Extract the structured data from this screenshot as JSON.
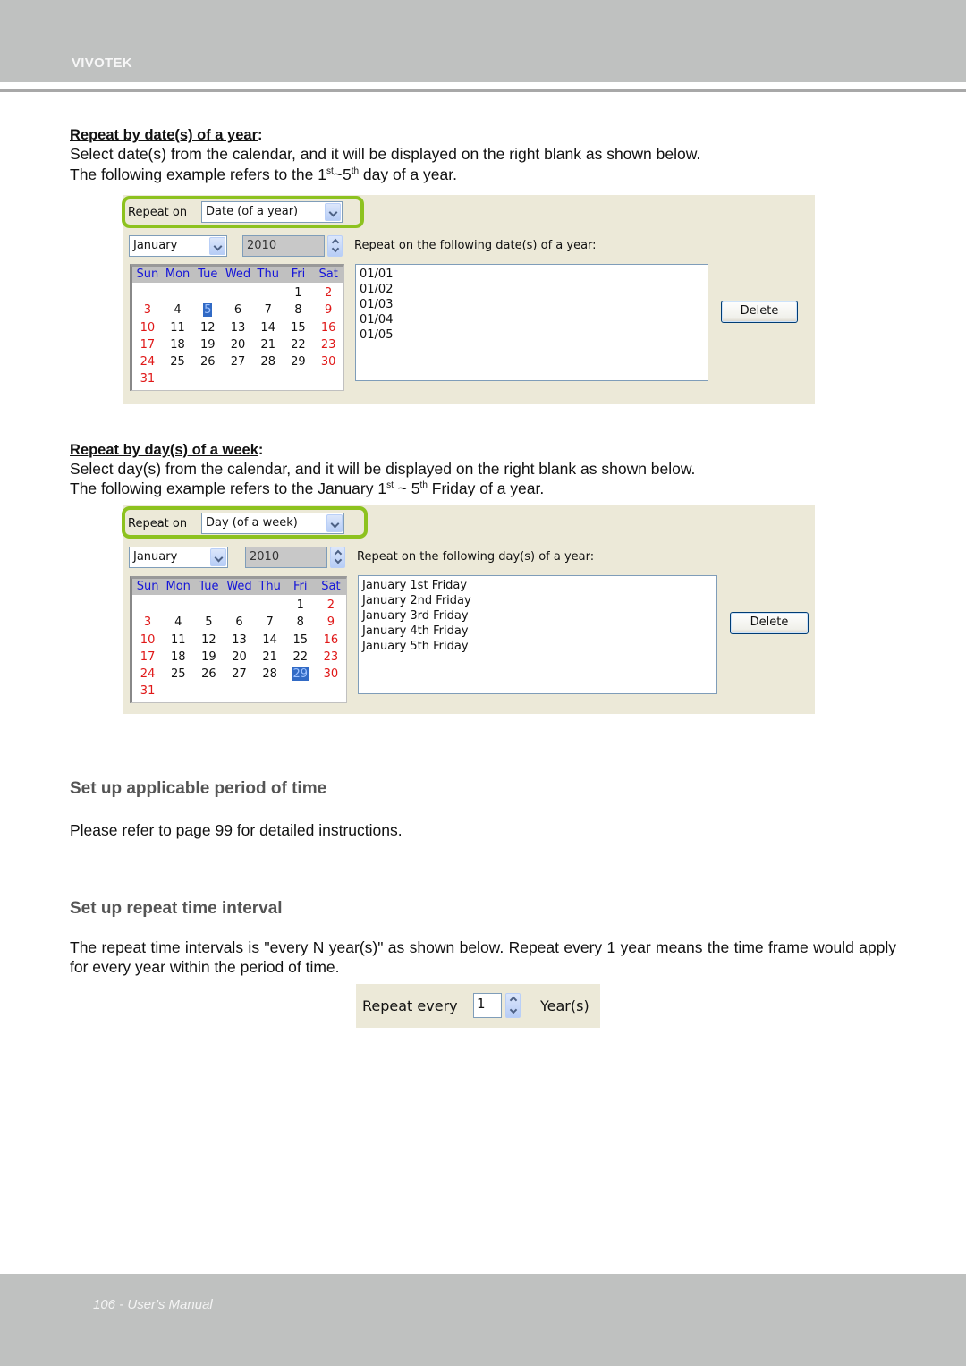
{
  "header": {
    "brand": "VIVOTEK"
  },
  "footer": {
    "page_label": "106 - User's Manual"
  },
  "section_dates": {
    "heading": "Repeat by date(s) of a year",
    "heading_suffix": ":",
    "line1": "Select date(s) from the calendar, and it will be displayed on the right blank as shown below.",
    "line2_pre": "The following example refers to the 1",
    "line2_sup1": "st",
    "line2_mid": "~5",
    "line2_sup2": "th",
    "line2_post": " day of a year."
  },
  "panel_dates": {
    "repeat_on_label": "Repeat on",
    "repeat_on_value": "Date (of a year)",
    "month_value": "January",
    "year_value": "2010",
    "list_label": "Repeat on the following date(s) of a year:",
    "list_items": [
      "01/01",
      "01/02",
      "01/03",
      "01/04",
      "01/05"
    ],
    "delete_label": "Delete",
    "weekdays": [
      "Sun",
      "Mon",
      "Tue",
      "Wed",
      "Thu",
      "Fri",
      "Sat"
    ],
    "selected_day": "5",
    "days": [
      "",
      "",
      "",
      "",
      "",
      "1",
      "2",
      "3",
      "4",
      "5",
      "6",
      "7",
      "8",
      "9",
      "10",
      "11",
      "12",
      "13",
      "14",
      "15",
      "16",
      "17",
      "18",
      "19",
      "20",
      "21",
      "22",
      "23",
      "24",
      "25",
      "26",
      "27",
      "28",
      "29",
      "30",
      "31"
    ]
  },
  "section_days": {
    "heading": "Repeat by day(s) of a week",
    "heading_suffix": ":",
    "line1": "Select day(s) from the calendar, and it will be displayed on the right blank as shown below.",
    "line2_pre": "The following example refers to the January 1",
    "line2_sup1": "st",
    "line2_mid": " ~ 5",
    "line2_sup2": "th",
    "line2_post": " Friday of a year."
  },
  "panel_days": {
    "repeat_on_label": "Repeat on",
    "repeat_on_value": "Day (of a week)",
    "month_value": "January",
    "year_value": "2010",
    "list_label": "Repeat on the following day(s) of a year:",
    "list_items": [
      "January 1st Friday",
      "January 2nd Friday",
      "January 3rd Friday",
      "January 4th Friday",
      "January 5th Friday"
    ],
    "delete_label": "Delete",
    "weekdays": [
      "Sun",
      "Mon",
      "Tue",
      "Wed",
      "Thu",
      "Fri",
      "Sat"
    ],
    "selected_day": "29",
    "days": [
      "",
      "",
      "",
      "",
      "",
      "1",
      "2",
      "3",
      "4",
      "5",
      "6",
      "7",
      "8",
      "9",
      "10",
      "11",
      "12",
      "13",
      "14",
      "15",
      "16",
      "17",
      "18",
      "19",
      "20",
      "21",
      "22",
      "23",
      "24",
      "25",
      "26",
      "27",
      "28",
      "29",
      "30",
      "31"
    ]
  },
  "section_period": {
    "title": "Set up applicable period of time",
    "body": "Please refer to page 99 for detailed instructions."
  },
  "section_interval": {
    "title": "Set up repeat time interval",
    "body": "The repeat time intervals is \"every N year(s)\" as shown below. Repeat every 1 year means the time frame would apply for every year within the period of time."
  },
  "panel_interval": {
    "label": "Repeat every",
    "value": "1",
    "unit": "Year(s)"
  },
  "colors": {
    "highlight": "#8dc21f",
    "weekend": "#e01818",
    "weekday_header": "#1414d8",
    "selection": "#316ac5",
    "header_bar": "#bfc1c0",
    "section_title": "#555555"
  }
}
